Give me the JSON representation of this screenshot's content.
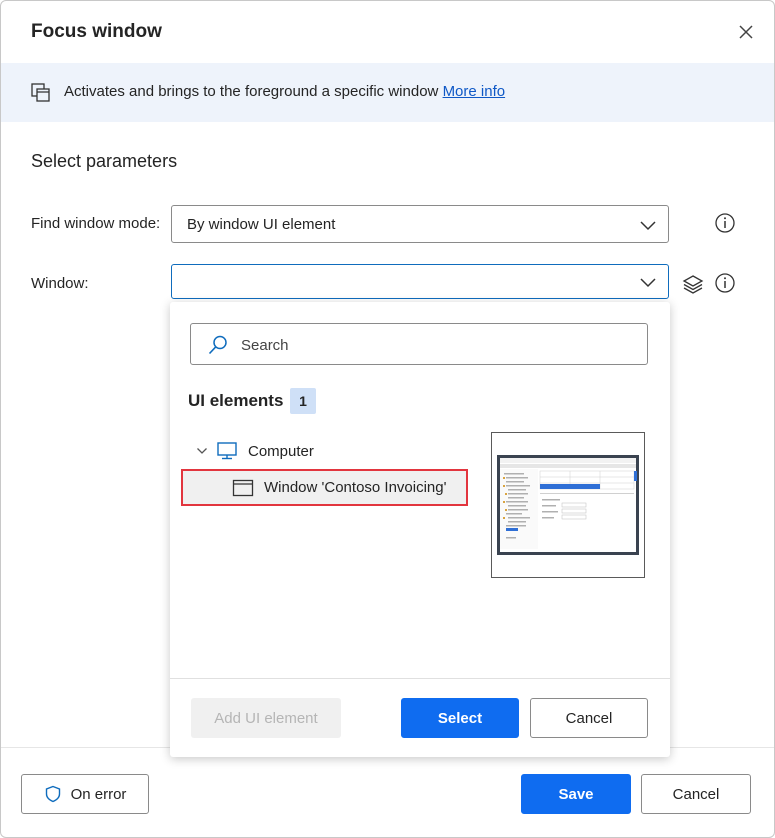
{
  "dialog": {
    "title": "Focus window",
    "info_text": "Activates and brings to the foreground a specific window",
    "info_link": "More info",
    "section_title": "Select parameters"
  },
  "fields": {
    "find_window_mode_label": "Find window mode:",
    "find_window_mode_value": "By window UI element",
    "window_label": "Window:",
    "window_value": ""
  },
  "dropdown": {
    "search_placeholder": "Search",
    "ui_elements_title": "UI elements",
    "ui_elements_count": "1",
    "tree": {
      "computer": "Computer",
      "window": "Window 'Contoso Invoicing'"
    },
    "add_button": "Add UI element",
    "select_button": "Select",
    "cancel_button": "Cancel"
  },
  "footer": {
    "on_error": "On error",
    "save": "Save",
    "cancel": "Cancel"
  },
  "colors": {
    "accent": "#0f6cf0",
    "info_bar": "#eef3fb",
    "highlight_border": "#e2353e",
    "link": "#0f58c6"
  },
  "icons": [
    "close-icon",
    "window-duplicate-icon",
    "chevron-down-icon",
    "info-icon",
    "layers-icon",
    "search-icon",
    "computer-icon",
    "window-icon",
    "shield-icon"
  ]
}
